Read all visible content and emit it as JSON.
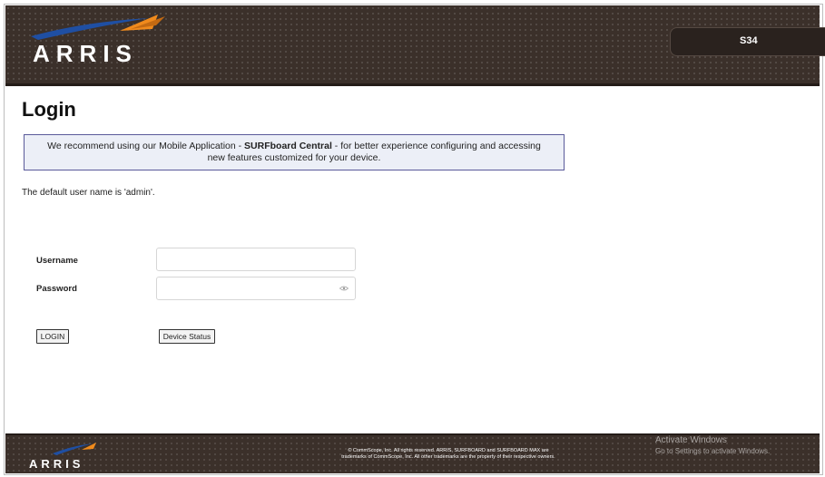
{
  "header": {
    "brand": "ARRIS",
    "model": "S34"
  },
  "main": {
    "title": "Login",
    "recommend": {
      "prefix": "We recommend using our Mobile Application - ",
      "app_name": "SURFboard Central",
      "suffix": " - for better experience configuring and accessing",
      "line2": "new features customized for your device."
    },
    "default_user_note": "The default user name is 'admin'.",
    "username": {
      "label": "Username",
      "value": "",
      "placeholder": ""
    },
    "password": {
      "label": "Password",
      "value": "",
      "placeholder": "",
      "icon": "eye-icon"
    },
    "buttons": {
      "login": "LOGIN",
      "device_status": "Device Status"
    }
  },
  "footer": {
    "brand": "ARRIS",
    "copyright_line1": "© CommScope, Inc. All rights reserved. ARRIS, SURFBOARD and SURFBOARD MAX are",
    "copyright_line2": "trademarks of CommScope, Inc. All other trademarks are the property of their respective owners."
  },
  "watermark": {
    "title": "Activate Windows",
    "subtitle": "Go to Settings to activate Windows."
  },
  "colors": {
    "header_bg": "#3b302a",
    "recommend_bg": "#eceff7",
    "recommend_border": "#5a5a9a",
    "logo_blue": "#1f4fa3",
    "logo_orange": "#f08a1c"
  }
}
